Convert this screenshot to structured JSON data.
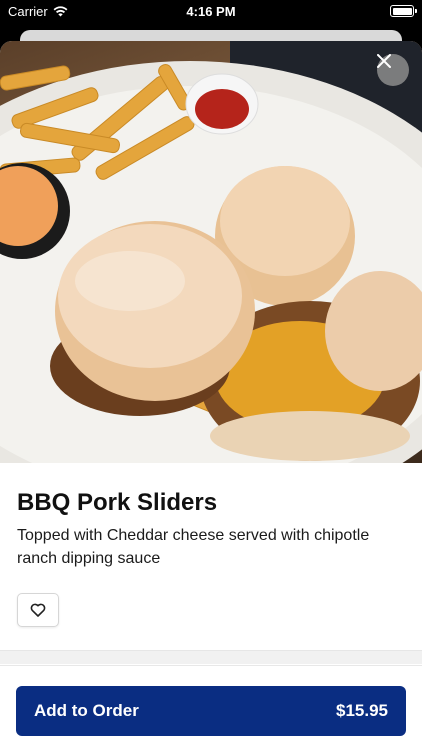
{
  "status_bar": {
    "carrier": "Carrier",
    "time": "4:16 PM"
  },
  "item": {
    "image_icon": "food-photo",
    "title": "BBQ Pork Sliders",
    "description": "Topped with Cheddar cheese served with chipotle ranch dipping sauce",
    "favorite_icon": "heart-outline-icon"
  },
  "order_bar": {
    "add_label": "Add to Order",
    "price": "$15.95"
  },
  "colors": {
    "primary": "#0a2d82",
    "close_bg": "#8c8c8c"
  }
}
